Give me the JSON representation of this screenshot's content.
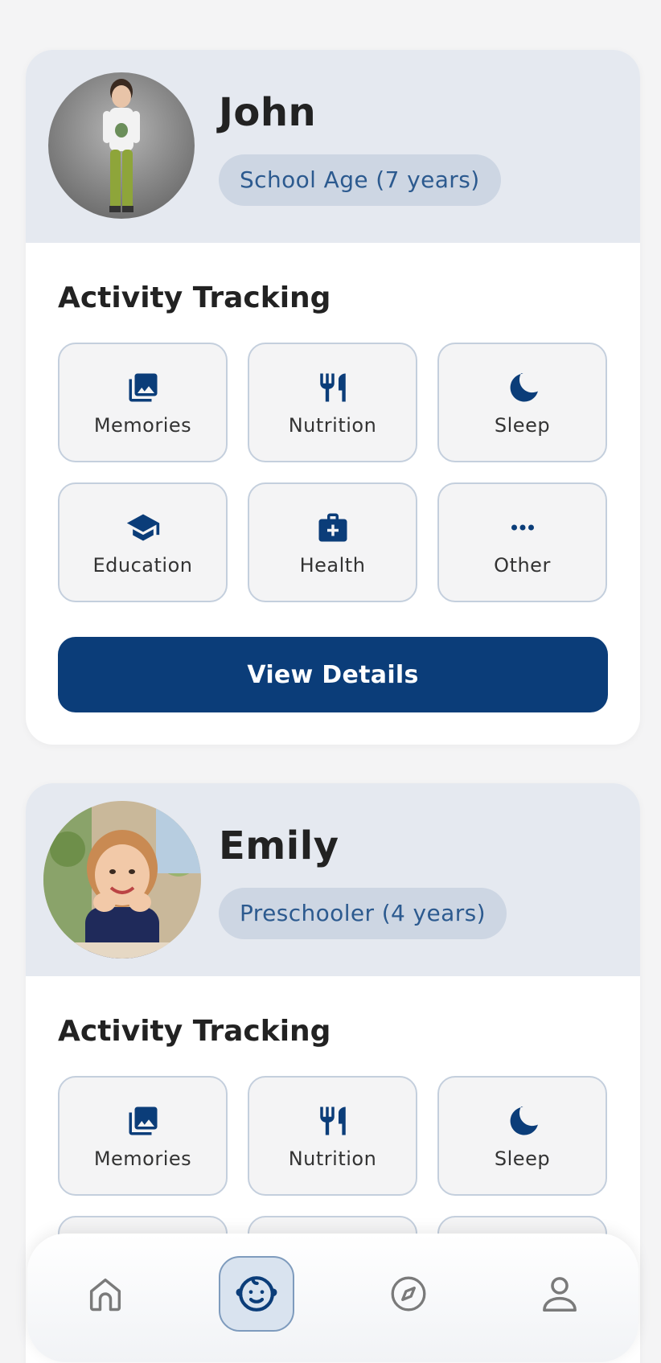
{
  "children": [
    {
      "name": "John",
      "age_label": "School Age (7 years)",
      "section_title": "Activity Tracking",
      "activities": [
        {
          "label": "Memories",
          "icon": "photo-library-icon"
        },
        {
          "label": "Nutrition",
          "icon": "utensils-icon"
        },
        {
          "label": "Sleep",
          "icon": "moon-icon"
        },
        {
          "label": "Education",
          "icon": "graduation-cap-icon"
        },
        {
          "label": "Health",
          "icon": "medical-kit-icon"
        },
        {
          "label": "Other",
          "icon": "more-dots-icon"
        }
      ],
      "button_label": "View Details"
    },
    {
      "name": "Emily",
      "age_label": "Preschooler (4 years)",
      "section_title": "Activity Tracking",
      "activities": [
        {
          "label": "Memories",
          "icon": "photo-library-icon"
        },
        {
          "label": "Nutrition",
          "icon": "utensils-icon"
        },
        {
          "label": "Sleep",
          "icon": "moon-icon"
        }
      ]
    }
  ],
  "nav": {
    "items": [
      {
        "icon": "home-icon",
        "active": false
      },
      {
        "icon": "baby-face-icon",
        "active": true
      },
      {
        "icon": "compass-icon",
        "active": false
      },
      {
        "icon": "user-icon",
        "active": false
      }
    ]
  },
  "colors": {
    "primary": "#0b3d79",
    "badge_bg": "#cdd6e3",
    "badge_text": "#2c5a8f",
    "header_bg": "#e5e9f0",
    "page_bg": "#f4f4f5"
  }
}
